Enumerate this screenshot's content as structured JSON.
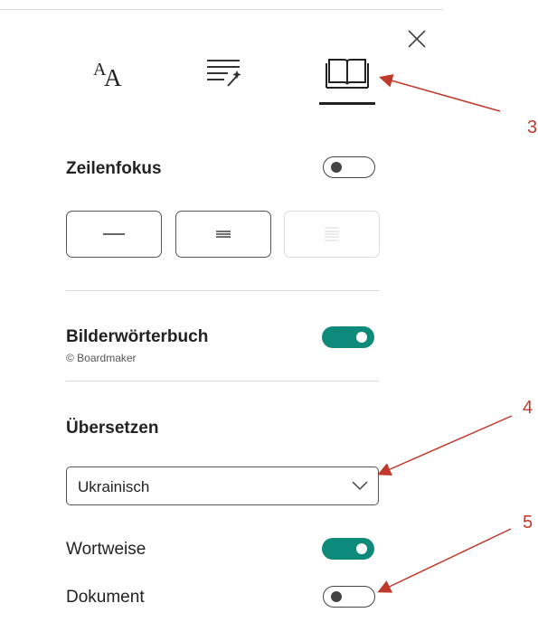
{
  "panel": {
    "close_icon": "close-icon",
    "tabs": [
      {
        "icon": "text-size-icon",
        "label": "AA"
      },
      {
        "icon": "text-options-icon"
      },
      {
        "icon": "book-icon",
        "active": true
      }
    ]
  },
  "line_focus": {
    "label": "Zeilenfokus",
    "toggle_on": false,
    "options": [
      "one-line",
      "three-lines",
      "five-lines"
    ]
  },
  "picture_dictionary": {
    "label": "Bilderwörterbuch",
    "sublabel": "© Boardmaker",
    "toggle_on": true
  },
  "translate": {
    "label": "Übersetzen",
    "selected_language": "Ukrainisch",
    "word_by_word": {
      "label": "Wortweise",
      "toggle_on": true
    },
    "document": {
      "label": "Dokument",
      "toggle_on": false
    }
  },
  "annotations": {
    "callout_3": "3",
    "callout_4": "4",
    "callout_5": "5",
    "color": "#c0392b"
  },
  "colors": {
    "accent": "#0e8a7a"
  }
}
